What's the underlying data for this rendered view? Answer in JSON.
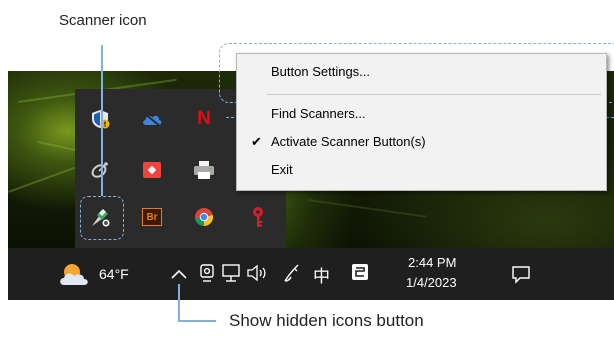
{
  "annotations": {
    "scanner_icon_label": "Scanner icon",
    "hidden_icons_label": "Show hidden icons button"
  },
  "context_menu": {
    "items": [
      {
        "label": "Button Settings...",
        "checked": false
      },
      {
        "label": "Find Scanners...",
        "checked": false
      },
      {
        "label": "Activate Scanner Button(s)",
        "checked": true
      },
      {
        "label": "Exit",
        "checked": false
      }
    ],
    "check_glyph": "✔"
  },
  "tray_icons": [
    {
      "name": "security-shield-icon",
      "color": "#e8e8e8"
    },
    {
      "name": "cloud-sync-icon",
      "color": "#4a8fd8"
    },
    {
      "name": "netflix-icon",
      "color": "#e50914",
      "glyph": "N"
    },
    {
      "name": "satellite-icon",
      "color": "#cccccc"
    },
    {
      "name": "anydesk-icon",
      "color": "#ef443b"
    },
    {
      "name": "printer-icon",
      "color": "#d9d9d9"
    },
    {
      "name": "scanner-icon",
      "color": "#bfe3a0"
    },
    {
      "name": "adobe-bridge-icon",
      "color": "#e07b1f",
      "glyph": "Br"
    },
    {
      "name": "chrome-icon",
      "color": "#fbc02d"
    },
    {
      "name": "key-icon",
      "color": "#d21f2e"
    }
  ],
  "taskbar": {
    "weather_temp": "64°F",
    "ime_char": "中",
    "time": "2:44 PM",
    "date": "1/4/2023"
  },
  "colors": {
    "annotation_accent": "#7fb1dc",
    "taskbar_bg": "#1f1f1f",
    "tray_bg": "#2b2b2b",
    "menu_bg": "#f2f2f2"
  }
}
